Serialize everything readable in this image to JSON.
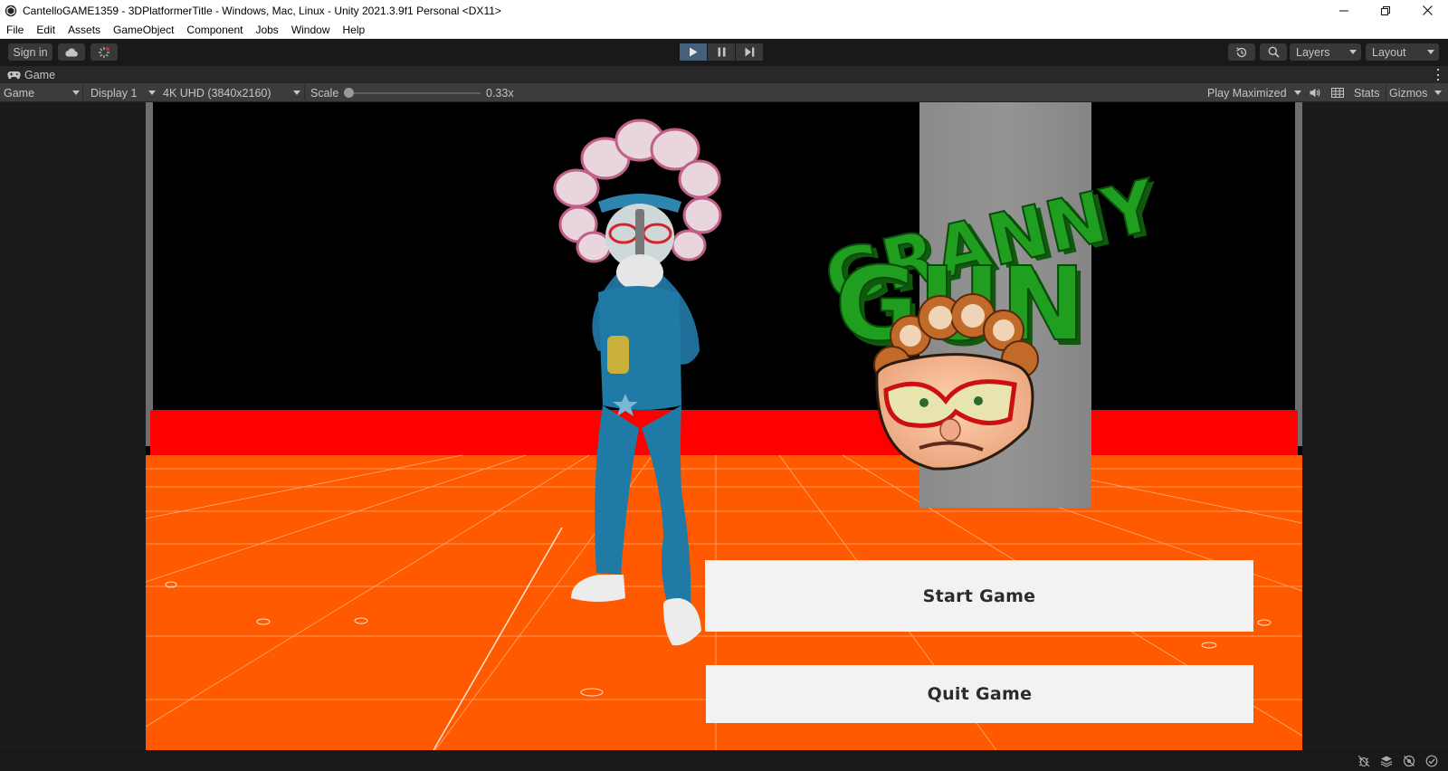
{
  "window": {
    "title": "CantelloGAME1359 - 3DPlatformerTitle - Windows, Mac, Linux - Unity 2021.3.9f1 Personal <DX11>",
    "controls": [
      "minimize",
      "restore",
      "close"
    ]
  },
  "menu": {
    "items": [
      "File",
      "Edit",
      "Assets",
      "GameObject",
      "Component",
      "Jobs",
      "Window",
      "Help"
    ]
  },
  "toolbar": {
    "sign_in": "Sign in",
    "play_state": "playing",
    "layers": "Layers",
    "layout": "Layout"
  },
  "game_tab": {
    "label": "Game"
  },
  "game_bar": {
    "mode": "Game",
    "display": "Display 1",
    "resolution": "4K UHD (3840x2160)",
    "scale_label": "Scale",
    "scale_value": "0.33x",
    "scale_fraction": 0.0,
    "play_mode": "Play Maximized",
    "stats": "Stats",
    "gizmos": "Gizmos"
  },
  "game": {
    "logo_line1": "GRANNY",
    "logo_line2": "GUN",
    "start_button": "Start Game",
    "quit_button": "Quit Game"
  },
  "colors": {
    "floor": "#ff5a00",
    "wall_red": "#ff0000",
    "pillar": "#8a8a8a",
    "logo_green": "#1f9e1f",
    "play_active": "#46607c",
    "button_bg": "#f2f2f2"
  }
}
